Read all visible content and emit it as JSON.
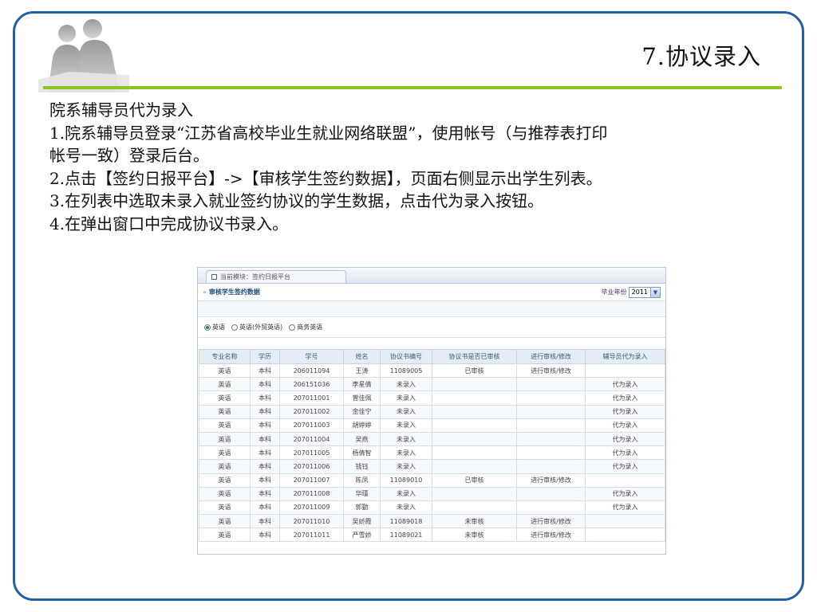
{
  "slide": {
    "title": "7.协议录入",
    "lines": [
      "院系辅导员代为录入",
      "1.院系辅导员登录“江苏省高校毕业生就业网络联盟”，使用帐号（与推荐表打印",
      "帐号一致）登录后台。",
      "2.点击【签约日报平台】->【审核学生签约数据】，页面右侧显示出学生列表。",
      "3.在列表中选取未录入就业签约协议的学生数据，点击代为录入按钮。",
      "4.在弹出窗口中完成协议书录入。"
    ],
    "accent_color": "#8dc21f",
    "frame_color": "#1f5fa8"
  },
  "screenshot": {
    "tab_label": "当前模块：签约日报平台",
    "header_title": "审核学生签约数据",
    "year_label": "毕业年份",
    "year_value": "2011",
    "radios": [
      {
        "label": "英语",
        "checked": true
      },
      {
        "label": "英语(外贸英语)",
        "checked": false
      },
      {
        "label": "商务英语",
        "checked": false
      }
    ],
    "columns": [
      "专业名称",
      "学历",
      "学号",
      "姓名",
      "协议书编号",
      "协议书是否已审核",
      "进行审核/修改",
      "辅导员代为录入"
    ],
    "rows": [
      {
        "major": "英语",
        "degree": "本科",
        "id": "206011094",
        "name": "王涛",
        "agreement": "11089005",
        "agreement_status": "ok",
        "audit": "已审核",
        "audit_status": "ok",
        "edit": "进行审核/修改",
        "proxy": ""
      },
      {
        "major": "英语",
        "degree": "本科",
        "id": "206151036",
        "name": "李星倩",
        "agreement": "未录入",
        "agreement_status": "missing",
        "audit": "",
        "audit_status": "",
        "edit": "",
        "proxy": "代为录入"
      },
      {
        "major": "英语",
        "degree": "本科",
        "id": "207011001",
        "name": "曾佳佩",
        "agreement": "未录入",
        "agreement_status": "missing",
        "audit": "",
        "audit_status": "",
        "edit": "",
        "proxy": "代为录入"
      },
      {
        "major": "英语",
        "degree": "本科",
        "id": "207011002",
        "name": "金佳宁",
        "agreement": "未录入",
        "agreement_status": "missing",
        "audit": "",
        "audit_status": "",
        "edit": "",
        "proxy": "代为录入"
      },
      {
        "major": "英语",
        "degree": "本科",
        "id": "207011003",
        "name": "胡婷婷",
        "agreement": "未录入",
        "agreement_status": "missing",
        "audit": "",
        "audit_status": "",
        "edit": "",
        "proxy": "代为录入"
      },
      {
        "major": "英语",
        "degree": "本科",
        "id": "207011004",
        "name": "吴燕",
        "agreement": "未录入",
        "agreement_status": "missing",
        "audit": "",
        "audit_status": "",
        "edit": "",
        "proxy": "代为录入"
      },
      {
        "major": "英语",
        "degree": "本科",
        "id": "207011005",
        "name": "杨倩智",
        "agreement": "未录入",
        "agreement_status": "missing",
        "audit": "",
        "audit_status": "",
        "edit": "",
        "proxy": "代为录入"
      },
      {
        "major": "英语",
        "degree": "本科",
        "id": "207011006",
        "name": "钱钰",
        "agreement": "未录入",
        "agreement_status": "missing",
        "audit": "",
        "audit_status": "",
        "edit": "",
        "proxy": "代为录入"
      },
      {
        "major": "英语",
        "degree": "本科",
        "id": "207011007",
        "name": "陈凤",
        "agreement": "11089010",
        "agreement_status": "ok",
        "audit": "已审核",
        "audit_status": "ok",
        "edit": "进行审核/修改",
        "proxy": ""
      },
      {
        "major": "英语",
        "degree": "本科",
        "id": "207011008",
        "name": "华瑾",
        "agreement": "未录入",
        "agreement_status": "missing",
        "audit": "",
        "audit_status": "",
        "edit": "",
        "proxy": "代为录入"
      },
      {
        "major": "英语",
        "degree": "本科",
        "id": "207011009",
        "name": "郭勤",
        "agreement": "未录入",
        "agreement_status": "missing",
        "audit": "",
        "audit_status": "",
        "edit": "",
        "proxy": "代为录入"
      },
      {
        "major": "英语",
        "degree": "本科",
        "id": "207011010",
        "name": "吴娇霞",
        "agreement": "11089018",
        "agreement_status": "ok",
        "audit": "未审核",
        "audit_status": "pending",
        "edit": "进行审核/修改",
        "proxy": ""
      },
      {
        "major": "英语",
        "degree": "本科",
        "id": "207011011",
        "name": "严雪娇",
        "agreement": "11089021",
        "agreement_status": "ok",
        "audit": "未审核",
        "audit_status": "pending",
        "edit": "进行审核/修改",
        "proxy": ""
      }
    ]
  }
}
